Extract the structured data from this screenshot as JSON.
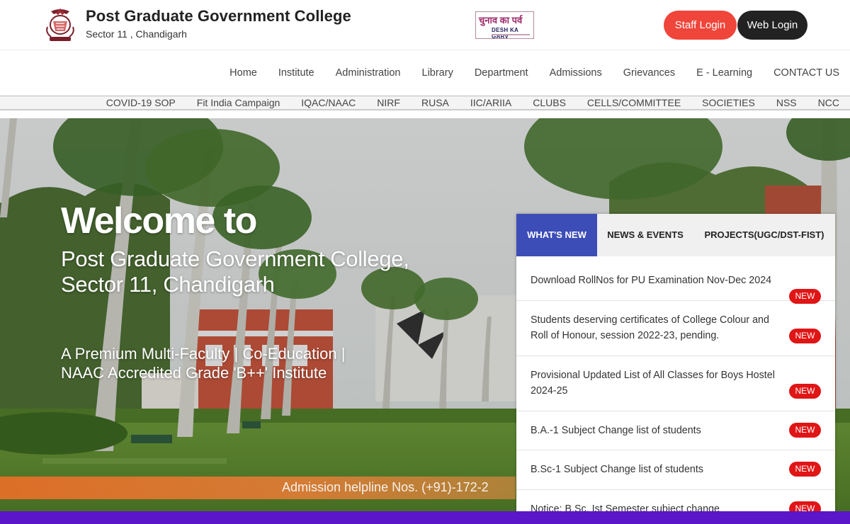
{
  "header": {
    "college_name": "Post Graduate Government College",
    "college_location": "Sector 11 , Chandigarh",
    "election_badge": {
      "hindi": "चुनाव का पर्व",
      "english": "DESH KA GARV"
    },
    "staff_login_label": "Staff Login",
    "web_login_label": "Web Login",
    "colors": {
      "staff_login": "#f0453a",
      "web_login": "#222222"
    }
  },
  "main_nav": {
    "items": [
      "Home",
      "Institute",
      "Administration",
      "Library",
      "Department",
      "Admissions",
      "Grievances",
      "E - Learning",
      "CONTACT US"
    ]
  },
  "sub_nav": {
    "items": [
      "COVID-19 SOP",
      "Fit India Campaign",
      "IQAC/NAAC",
      "NIRF",
      "RUSA",
      "IIC/ARIIA",
      "CLUBS",
      "CELLS/COMMITTEE",
      "SOCIETIES",
      "NSS",
      "NCC"
    ]
  },
  "hero": {
    "welcome": "Welcome to",
    "title_line1": "Post Graduate Government College,",
    "title_line2": "Sector 11, Chandigarh",
    "tagline_line1": "A Premium Multi-Faculty | Co-Education |",
    "tagline_line2": "NAAC Accredited Grade 'B++' Institute",
    "helpline": "Admission helpline Nos. (+91)-172-2"
  },
  "news_panel": {
    "tabs": [
      {
        "label": "WHAT'S NEW",
        "active": true
      },
      {
        "label": "NEWS & EVENTS",
        "active": false
      },
      {
        "label": "PROJECTS(UGC/DST-FIST)",
        "active": false
      }
    ],
    "badge_label": "NEW",
    "items": [
      {
        "text": "Download RollNos for PU Examination Nov-Dec 2024"
      },
      {
        "text": "Students deserving certificates of College Colour and Roll of Honour, session 2022-23, pending."
      },
      {
        "text": "Provisional Updated List of All Classes for Boys Hostel 2024-25"
      },
      {
        "text": "B.A.-1 Subject Change list of students"
      },
      {
        "text": "B.Sc-1 Subject Change list of students"
      },
      {
        "text": "Notice: B.Sc. Ist Semester subject change"
      }
    ],
    "colors": {
      "active_tab": "#3d4db7",
      "badge": "#e01515"
    }
  }
}
